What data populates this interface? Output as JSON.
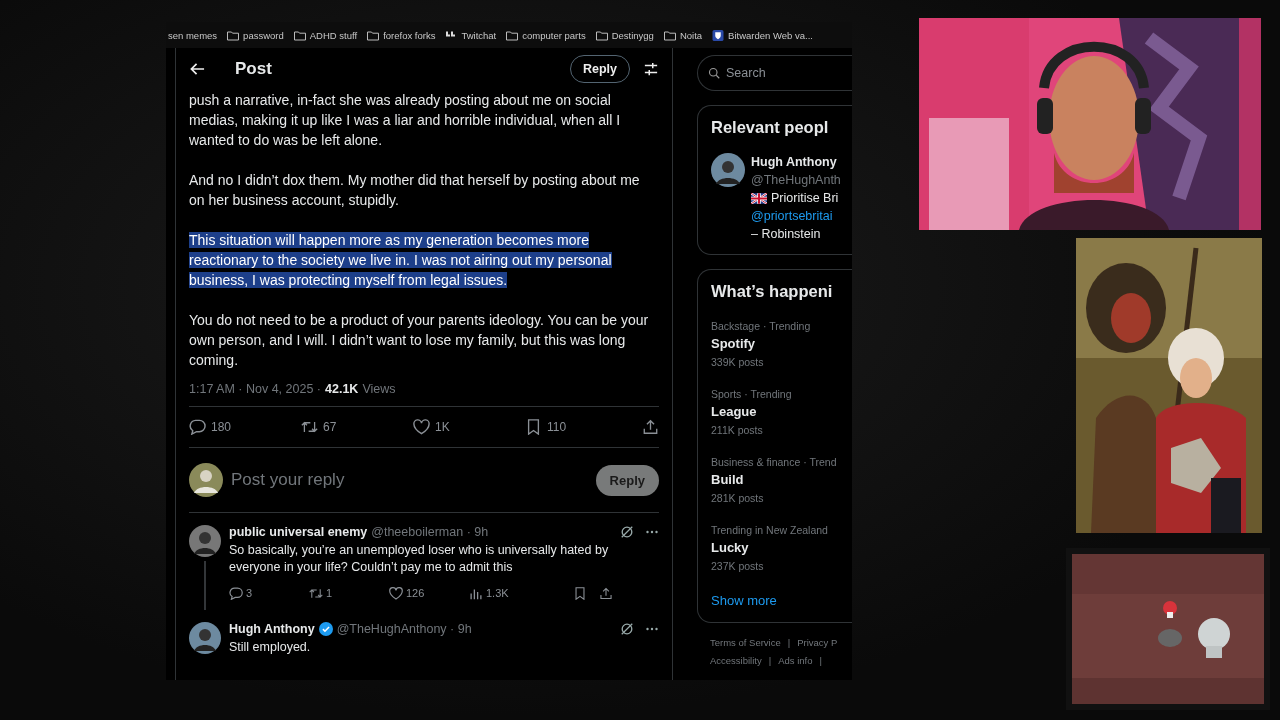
{
  "bookmarks": [
    {
      "label": "sen memes",
      "kind": "plain"
    },
    {
      "label": "password",
      "kind": "folder"
    },
    {
      "label": "ADHD stuff",
      "kind": "folder"
    },
    {
      "label": "forefox forks",
      "kind": "folder"
    },
    {
      "label": "Twitchat",
      "kind": "app"
    },
    {
      "label": "computer parts",
      "kind": "folder"
    },
    {
      "label": "Destinygg",
      "kind": "folder"
    },
    {
      "label": "Noita",
      "kind": "folder"
    },
    {
      "label": "Bitwarden Web va...",
      "kind": "shield"
    }
  ],
  "header": {
    "title": "Post",
    "button": "Reply"
  },
  "search": {
    "placeholder": "Search"
  },
  "post": {
    "paragraphs": [
      {
        "text": "push a narrative, in-fact she was already posting about me on social medias, making it up like I was a liar and horrible individual, when all I wanted to do was be left alone.",
        "highlighted": false
      },
      {
        "text": "And no I didn’t dox them. My mother did that herself by posting about me on her business account, stupidly.",
        "highlighted": false
      },
      {
        "text": "This situation will happen more as my generation becomes more reactionary to the society we live in. I was not airing out my personal business, I was protecting myself from legal issues.",
        "highlighted": true
      },
      {
        "text": "You do not need to be a product of your parents ideology. You can be your own person, and I will. I didn’t want to lose my family, but this was long coming.",
        "highlighted": false
      }
    ],
    "time": "1:17 AM · Nov 4, 2025 ·",
    "views_count": "42.1K",
    "views_label": "Views",
    "actions": [
      {
        "kind": "reply",
        "count": "180"
      },
      {
        "kind": "repost",
        "count": "67"
      },
      {
        "kind": "like",
        "count": "1K"
      },
      {
        "kind": "bookmark",
        "count": "110"
      },
      {
        "kind": "share"
      }
    ]
  },
  "compose": {
    "placeholder": "Post your reply",
    "button": "Reply"
  },
  "replies": [
    {
      "name": "public universal enemy",
      "verified": false,
      "handle": "@theeboilerman · 9h",
      "text": "So basically, you’re an unemployed loser who is universally hated by everyone in your life? Couldn’t pay me to admit this",
      "actions": [
        {
          "kind": "reply",
          "count": "3"
        },
        {
          "kind": "repost",
          "count": "1"
        },
        {
          "kind": "like",
          "count": "126"
        },
        {
          "kind": "views",
          "count": "1.3K"
        },
        {
          "kind": "bookmark"
        },
        {
          "kind": "share"
        }
      ]
    },
    {
      "name": "Hugh Anthony",
      "verified": true,
      "handle": "@TheHughAnthony · 9h",
      "text": "Still employed."
    }
  ],
  "relevant": {
    "title": "Relevant peopl",
    "name": "Hugh Anthony",
    "handle": "@TheHughAnth",
    "bio": "Prioritise Bri",
    "link": "@priortsebritai",
    "signature": "– Robinstein"
  },
  "trending": {
    "title": "What’s happeni",
    "items": [
      {
        "context": "Backstage · Trending",
        "topic": "Spotify",
        "posts": "339K posts"
      },
      {
        "context": "Sports · Trending",
        "topic": "League",
        "posts": "211K posts"
      },
      {
        "context": "Business & finance · Trend",
        "topic": "Build",
        "posts": "281K posts"
      },
      {
        "context": "Trending in New Zealand",
        "topic": "Lucky",
        "posts": "237K posts"
      }
    ],
    "show_more": "Show more"
  },
  "footer": [
    [
      {
        "label": "Terms of Service",
        "sep": "|"
      },
      {
        "label": "Privacy P"
      }
    ],
    [
      {
        "label": "Accessibility",
        "sep": "|"
      },
      {
        "label": "Ads info",
        "sep": "|"
      }
    ]
  ]
}
